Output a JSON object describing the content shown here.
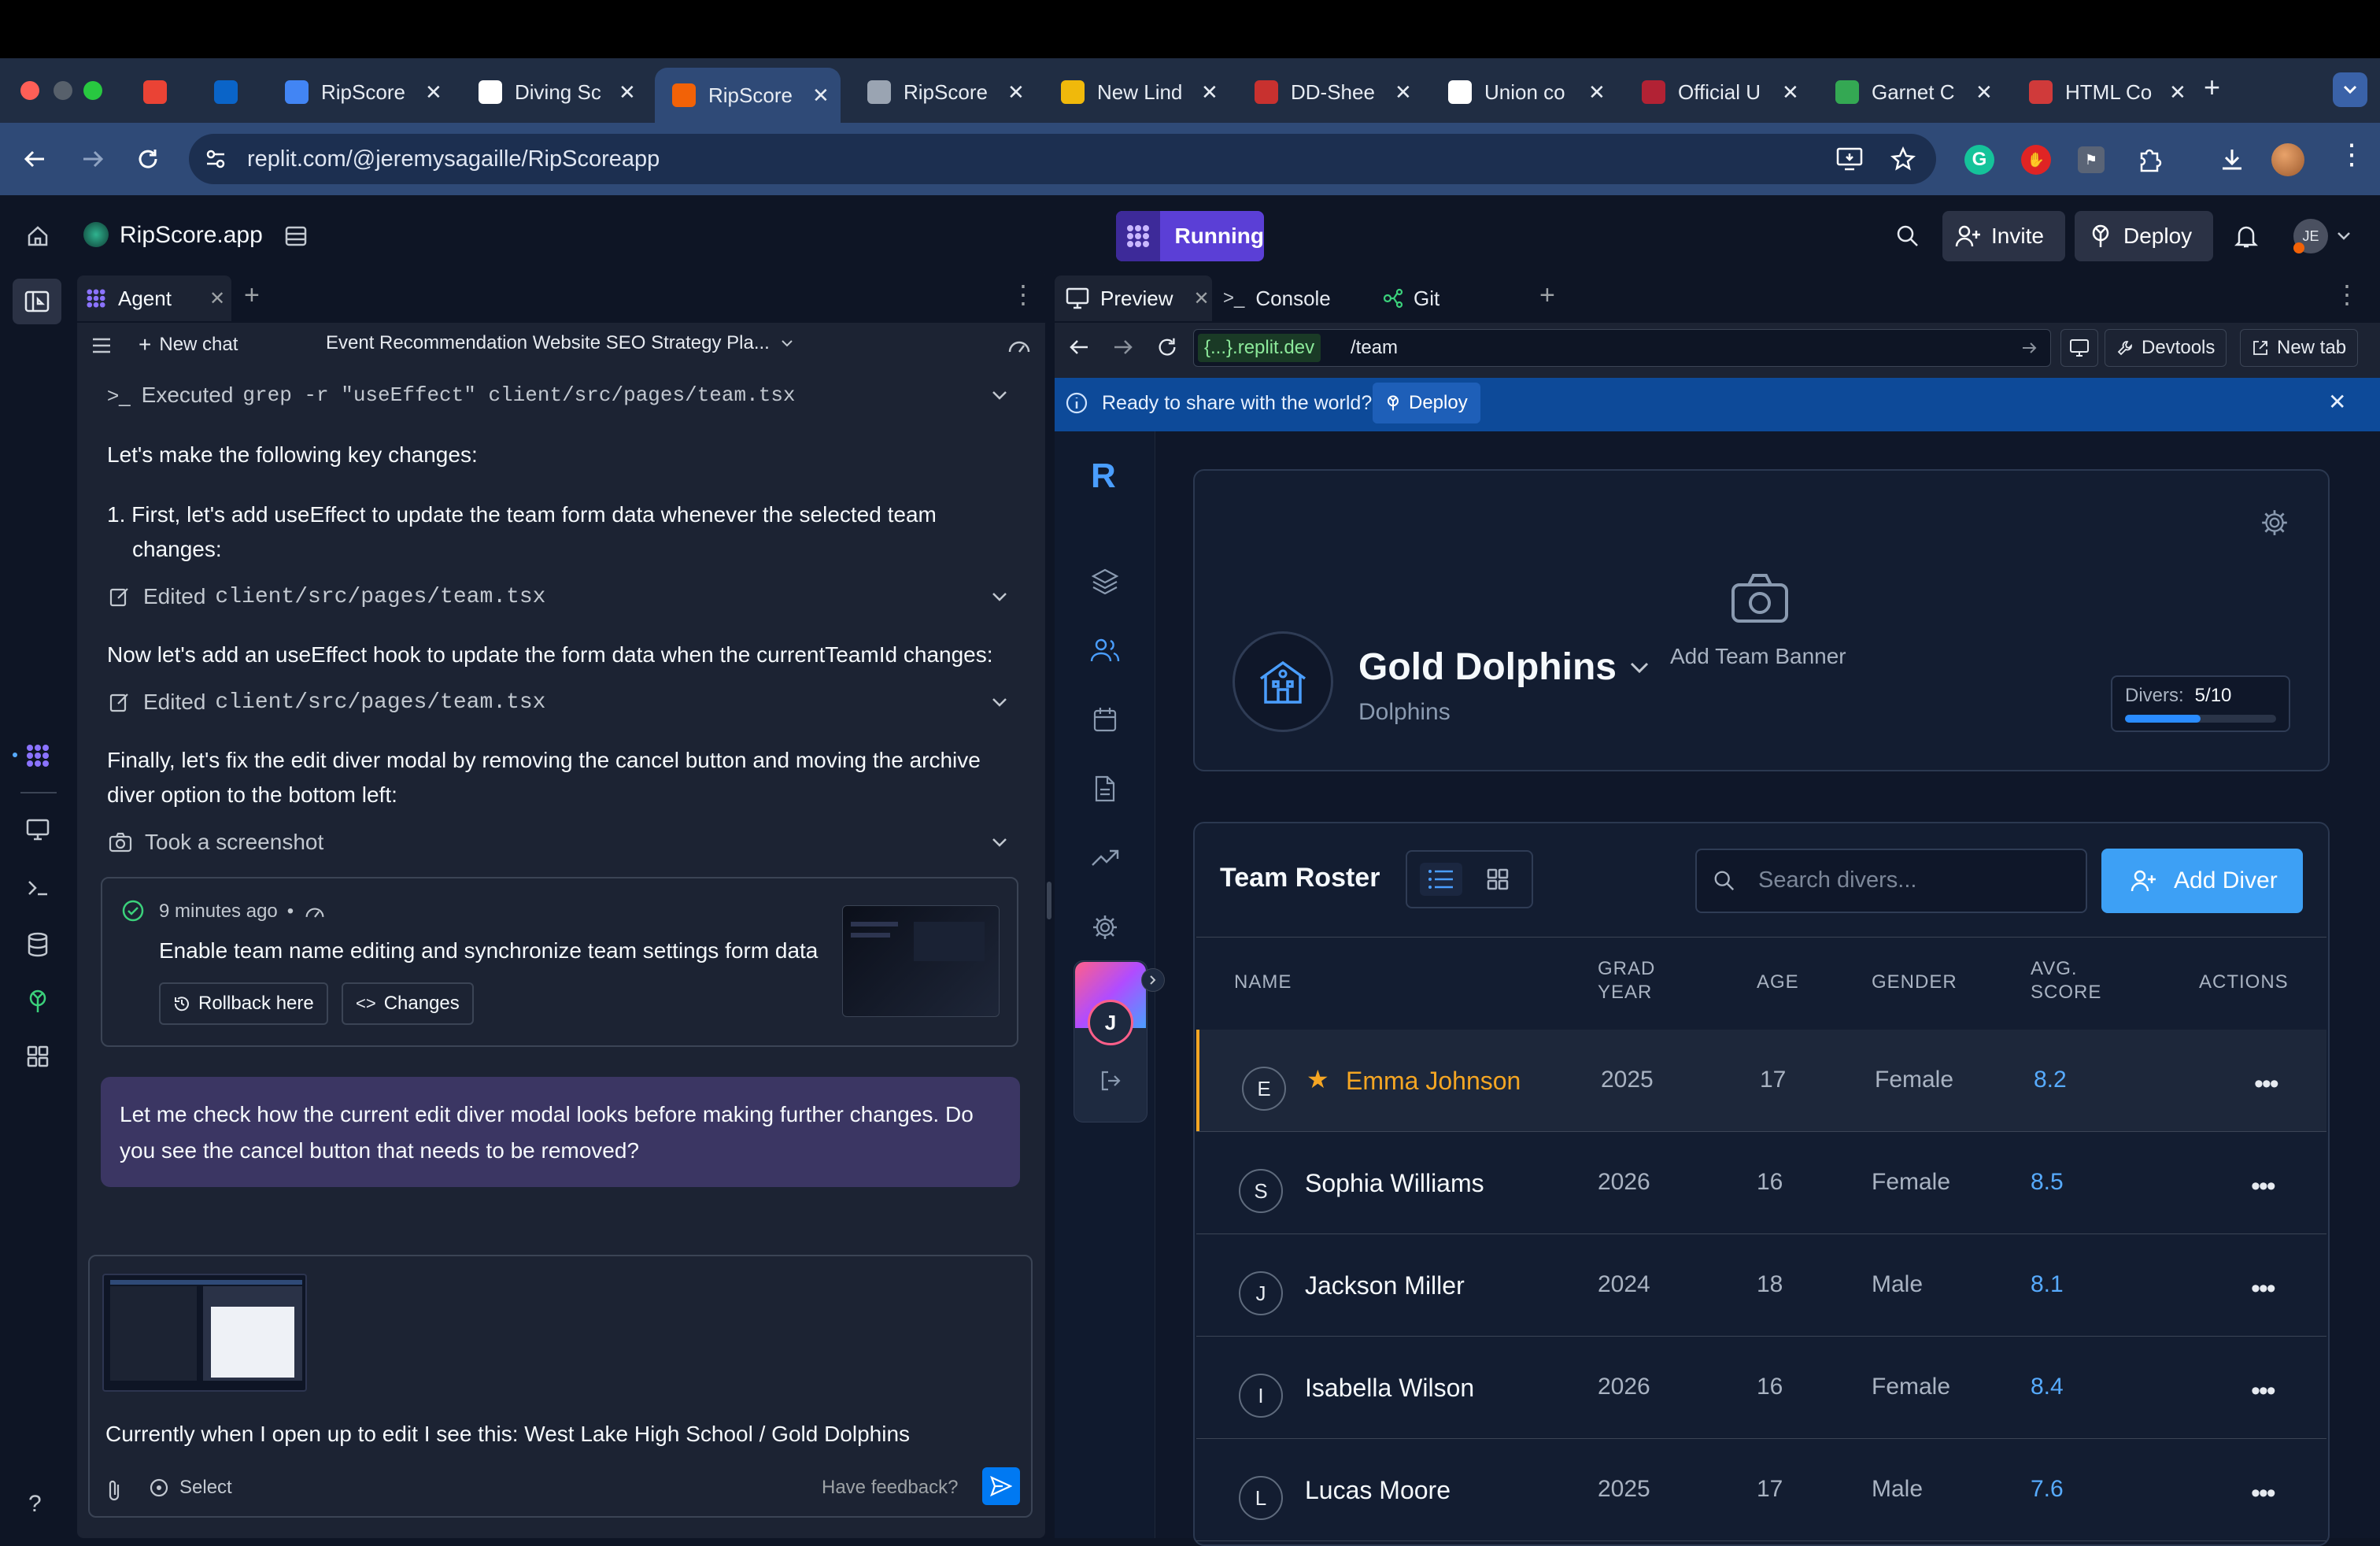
{
  "browser": {
    "tabs": [
      {
        "label": "",
        "icon": "gmail-icon",
        "color": "#ea4335"
      },
      {
        "label": "",
        "icon": "outlook-icon",
        "color": "#0a64c8"
      },
      {
        "label": "RipScore",
        "icon": "docs-icon",
        "color": "#4285f4"
      },
      {
        "label": "Diving Sc",
        "icon": "openai-icon",
        "color": "#ffffff"
      },
      {
        "label": "RipScore",
        "icon": "replit-icon",
        "color": "#f26207",
        "active": true
      },
      {
        "label": "RipScore",
        "icon": "globe-icon",
        "color": "#9aa4b2"
      },
      {
        "label": "New Lind",
        "icon": "binance-icon",
        "color": "#f0b90b"
      },
      {
        "label": "DD-Shee",
        "icon": "pdf-icon",
        "color": "#c8312f"
      },
      {
        "label": "Union co",
        "icon": "google-icon",
        "color": "#ffffff"
      },
      {
        "label": "Official U",
        "icon": "university-icon",
        "color": "#b22234"
      },
      {
        "label": "Garnet C",
        "icon": "drive-icon",
        "color": "#34a853"
      },
      {
        "label": "HTML Co",
        "icon": "html-icon",
        "color": "#d03a3a"
      }
    ],
    "tab_close": "✕",
    "new_tab": "+",
    "url": "replit.com/@jeremysagaille/RipScoreapp"
  },
  "app": {
    "project_name": "RipScore.app",
    "run_status": "Running",
    "invite_label": "Invite",
    "deploy_label": "Deploy",
    "user_initials": "JE"
  },
  "agent": {
    "tab_label": "Agent",
    "new_chat_label": "New chat",
    "chat_title": "Event Recommendation Website SEO Strategy Pla...",
    "executed_prefix": "Executed",
    "executed_cmd": "grep -r \"useEffect\" client/src/pages/team.tsx",
    "msg1": "Let's make the following key changes:",
    "list_item_1a": "1. First, let's add useEffect to update the team form data whenever the selected team",
    "list_item_1b": "changes:",
    "edited_prefix": "Edited",
    "edited_file": "client/src/pages/team.tsx",
    "msg2": "Now let's add an useEffect hook to update the form data when the currentTeamId changes:",
    "msg3a": "Finally, let's fix the edit diver modal by removing the cancel button and moving the archive",
    "msg3b": "diver option to the bottom left:",
    "screenshot_label": "Took a screenshot",
    "checkpoint_time": "9 minutes ago",
    "checkpoint_sep": "•",
    "checkpoint_title": "Enable team name editing and synchronize team settings form data",
    "rollback_label": "Rollback here",
    "changes_label": "Changes",
    "assistant_msg_a": "Let me check how the current edit diver modal looks before making further changes. Do",
    "assistant_msg_b": "you see the cancel button that needs to be removed?",
    "input_text": "Currently when I open up to edit I see this: West Lake High School / Gold Dolphins",
    "select_label": "Select",
    "feedback_label": "Have feedback?"
  },
  "preview": {
    "tabs": {
      "preview": "Preview",
      "console": "Console",
      "git": "Git"
    },
    "url_host": "{...}.replit.dev",
    "url_path": "/team",
    "devtools_label": "Devtools",
    "newtab_label": "New tab",
    "banner_text": "Ready to share with the world?",
    "banner_deploy": "Deploy",
    "logo_letter": "R",
    "user_initial": "J",
    "team_name": "Gold Dolphins",
    "team_sub": "Dolphins",
    "add_banner": "Add Team Banner",
    "divers_label": "Divers:",
    "divers_value": "5/10",
    "divers_fraction": 0.5,
    "roster_title": "Team Roster",
    "search_placeholder": "Search divers...",
    "add_diver_label": "Add Diver",
    "columns": {
      "name": "NAME",
      "grad1": "GRAD",
      "grad2": "YEAR",
      "age": "AGE",
      "gender": "GENDER",
      "score1": "AVG.",
      "score2": "SCORE",
      "actions": "ACTIONS"
    },
    "rows": [
      {
        "initial": "E",
        "name": "Emma Johnson",
        "year": "2025",
        "age": "17",
        "gender": "Female",
        "score": "8.2",
        "starred": true
      },
      {
        "initial": "S",
        "name": "Sophia Williams",
        "year": "2026",
        "age": "16",
        "gender": "Female",
        "score": "8.5"
      },
      {
        "initial": "J",
        "name": "Jackson Miller",
        "year": "2024",
        "age": "18",
        "gender": "Male",
        "score": "8.1"
      },
      {
        "initial": "I",
        "name": "Isabella Wilson",
        "year": "2026",
        "age": "16",
        "gender": "Female",
        "score": "8.4"
      },
      {
        "initial": "L",
        "name": "Lucas Moore",
        "year": "2025",
        "age": "17",
        "gender": "Male",
        "score": "7.6"
      }
    ],
    "actions_glyph": "•••"
  },
  "colors": {
    "accent_blue": "#0079f2",
    "link_blue": "#57abff",
    "star_orange": "#f5a623",
    "running_purple": "#5b3fd6"
  }
}
